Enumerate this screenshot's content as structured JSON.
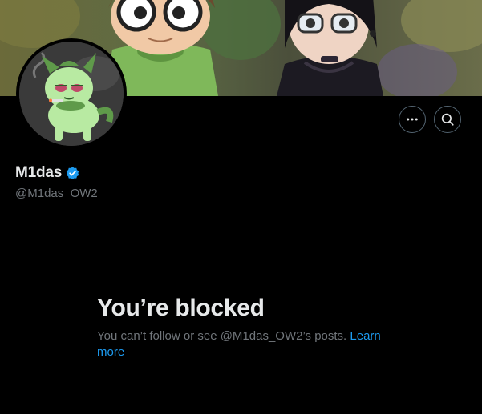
{
  "profile": {
    "display_name": "M1das",
    "handle": "@M1das_OW2",
    "verified": true
  },
  "icons": {
    "more": "more-horizontal-icon",
    "search": "search-icon",
    "verified": "verified-badge-icon"
  },
  "blocked": {
    "title": "You’re blocked",
    "message": "You can’t follow or see @M1das_OW2’s posts.",
    "link_label": "Learn more"
  },
  "colors": {
    "background": "#000000",
    "text_primary": "#e7e9ea",
    "text_secondary": "#71767b",
    "link": "#1d9bf0",
    "verified": "#1d9bf0",
    "button_border": "#536471"
  }
}
